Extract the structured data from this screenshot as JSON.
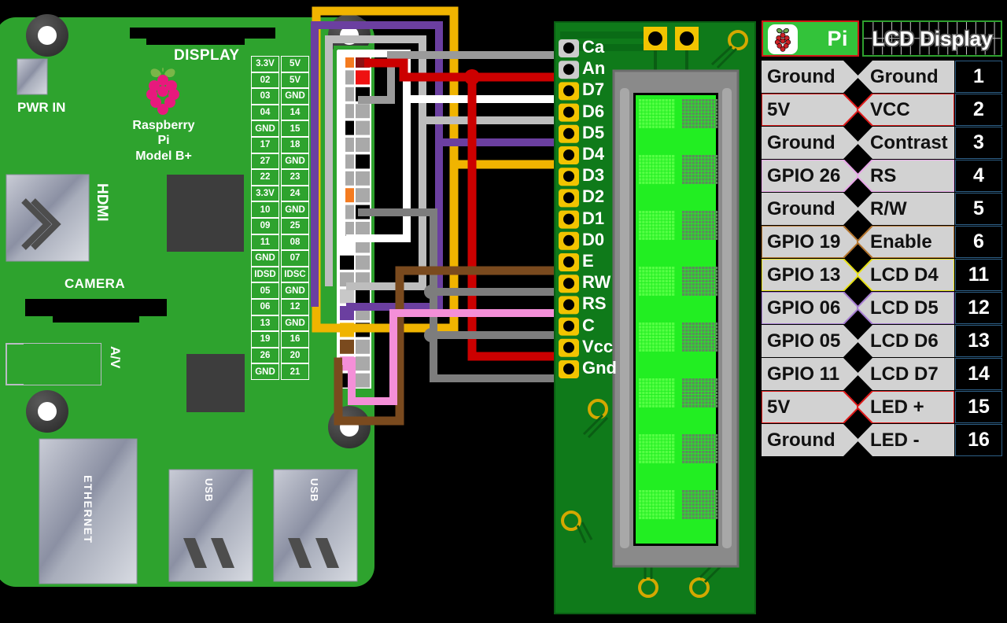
{
  "board": {
    "name_lines": [
      "Raspberry",
      "Pi",
      "Model B+"
    ],
    "labels": {
      "display": "DISPLAY",
      "power": "PWR IN",
      "camera": "CAMERA",
      "hdmi": "HDMI",
      "av": "A/V",
      "ethernet": "ETHERNET",
      "usb1": "USB",
      "usb2": "USB"
    },
    "colors": {
      "pcb": "#2ea32e",
      "logo": "#e8197d",
      "leaf": "#7ab648"
    }
  },
  "gpio_header": {
    "rows": [
      [
        "3.3V",
        "5V"
      ],
      [
        "02",
        "5V"
      ],
      [
        "03",
        "GND"
      ],
      [
        "04",
        "14"
      ],
      [
        "GND",
        "15"
      ],
      [
        "17",
        "18"
      ],
      [
        "27",
        "GND"
      ],
      [
        "22",
        "23"
      ],
      [
        "3.3V",
        "24"
      ],
      [
        "10",
        "GND"
      ],
      [
        "09",
        "25"
      ],
      [
        "11",
        "08"
      ],
      [
        "GND",
        "07"
      ],
      [
        "IDSD",
        "IDSC"
      ],
      [
        "05",
        "GND"
      ],
      [
        "06",
        "12"
      ],
      [
        "13",
        "GND"
      ],
      [
        "19",
        "16"
      ],
      [
        "26",
        "20"
      ],
      [
        "GND",
        "21"
      ]
    ],
    "pin_fills": [
      [
        "#f47b20",
        "#8b1212"
      ],
      [
        "#a9a9a9",
        "#ee1111"
      ],
      [
        "#a9a9a9",
        "#000000"
      ],
      [
        "#a9a9a9",
        "#a9a9a9"
      ],
      [
        "#000000",
        "#a9a9a9"
      ],
      [
        "#a9a9a9",
        "#a9a9a9"
      ],
      [
        "#a9a9a9",
        "#000000"
      ],
      [
        "#a9a9a9",
        "#a9a9a9"
      ],
      [
        "#f47b20",
        "#a9a9a9"
      ],
      [
        "#a9a9a9",
        "#000000"
      ],
      [
        "#a9a9a9",
        "#a9a9a9"
      ],
      [
        "#ffffff",
        "#a9a9a9"
      ],
      [
        "#000000",
        "#a9a9a9"
      ],
      [
        "#a9a9a9",
        "#a9a9a9"
      ],
      [
        "#c8c8c8",
        "#000000"
      ],
      [
        "#6b3fa0",
        "#a9a9a9"
      ],
      [
        "#f0b400",
        "#000000"
      ],
      [
        "#7a4a1e",
        "#a9a9a9"
      ],
      [
        "#f48fd8",
        "#a9a9a9"
      ],
      [
        "#000000",
        "#a9a9a9"
      ]
    ]
  },
  "lcd_module": {
    "pins": [
      "Ca",
      "An",
      "D7",
      "D6",
      "D5",
      "D4",
      "D3",
      "D2",
      "D1",
      "D0",
      "E",
      "RW",
      "RS",
      "C",
      "Vcc",
      "Gnd"
    ],
    "pad_colors": [
      "#cccccc",
      "#cccccc",
      "#f2c400",
      "#f2c400",
      "#f2c400",
      "#f2c400",
      "#f2c400",
      "#f2c400",
      "#f2c400",
      "#f2c400",
      "#f2c400",
      "#f2c400",
      "#f2c400",
      "#f2c400",
      "#f2c400",
      "#f2c400"
    ],
    "screen_color": "#22ee22",
    "pcb_color": "#0f7a1a"
  },
  "wires": [
    {
      "name": "cathode-gray",
      "color": "#9a9a9a",
      "from_pin": "GND 06",
      "to_pin": "Ca"
    },
    {
      "name": "anode-red",
      "color": "#cc0000",
      "from_pin": "5V",
      "to_pin": "An"
    },
    {
      "name": "d7-white",
      "color": "#ffffff",
      "from_pin": "GPIO 11",
      "to_pin": "D7"
    },
    {
      "name": "d6-lightgray",
      "color": "#bdbdbd",
      "from_pin": "GPIO 05",
      "to_pin": "D6"
    },
    {
      "name": "d5-purple",
      "color": "#6b3fa0",
      "from_pin": "GPIO 06",
      "to_pin": "D5"
    },
    {
      "name": "d4-yellow",
      "color": "#f0b400",
      "from_pin": "GPIO 13",
      "to_pin": "D4"
    },
    {
      "name": "enable-brown",
      "color": "#7a4a1e",
      "from_pin": "GPIO 19",
      "to_pin": "E"
    },
    {
      "name": "rw-gray",
      "color": "#7d7d7d",
      "from_pin": "Ground",
      "to_pin": "RW"
    },
    {
      "name": "rs-pink",
      "color": "#f48fd8",
      "from_pin": "GPIO 26",
      "to_pin": "RS"
    },
    {
      "name": "contrast-gray",
      "color": "#7d7d7d",
      "from_pin": "Ground",
      "to_pin": "C"
    },
    {
      "name": "vcc-red",
      "color": "#cc0000",
      "from_pin": "5V",
      "to_pin": "Vcc"
    },
    {
      "name": "gnd-gray",
      "color": "#7d7d7d",
      "from_pin": "Ground",
      "to_pin": "Gnd"
    }
  ],
  "table": {
    "header": {
      "pi": "Pi",
      "lcd": "LCD Display"
    },
    "rows": [
      {
        "pi": "Ground",
        "lcd": "Ground",
        "pin": "1",
        "accent": "none"
      },
      {
        "pi": "5V",
        "lcd": "VCC",
        "pin": "2",
        "accent": "#e01b1b"
      },
      {
        "pi": "Ground",
        "lcd": "Contrast",
        "pin": "3",
        "accent": "none"
      },
      {
        "pi": "GPIO 26",
        "lcd": "RS",
        "pin": "4",
        "accent": "#e8a6e8"
      },
      {
        "pi": "Ground",
        "lcd": "R/W",
        "pin": "5",
        "accent": "none"
      },
      {
        "pi": "GPIO 19",
        "lcd": "Enable",
        "pin": "6",
        "accent": "#b5762f"
      },
      {
        "pi": "GPIO 13",
        "lcd": "LCD D4",
        "pin": "11",
        "accent": "#e8e21a"
      },
      {
        "pi": "GPIO 06",
        "lcd": "LCD D5",
        "pin": "12",
        "accent": "#a87fd4"
      },
      {
        "pi": "GPIO 05",
        "lcd": "LCD D6",
        "pin": "13",
        "accent": "none"
      },
      {
        "pi": "GPIO 11",
        "lcd": "LCD D7",
        "pin": "14",
        "accent": "none"
      },
      {
        "pi": "5V",
        "lcd": "LED +",
        "pin": "15",
        "accent": "#e01b1b"
      },
      {
        "pi": "Ground",
        "lcd": "LED -",
        "pin": "16",
        "accent": "none"
      }
    ]
  }
}
